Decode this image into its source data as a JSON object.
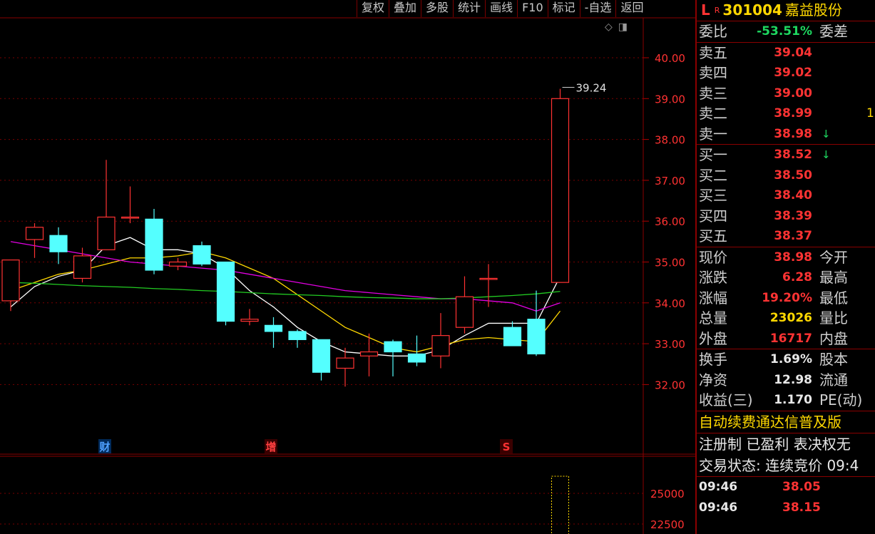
{
  "toolbar": [
    "复权",
    "叠加",
    "多股",
    "统计",
    "画线",
    "F10",
    "标记",
    "-自选",
    "返回"
  ],
  "chart_data": {
    "type": "candlestick",
    "y_ticks": [
      "40.00",
      "39.00",
      "38.00",
      "37.00",
      "36.00",
      "35.00",
      "34.00",
      "33.00",
      "32.00"
    ],
    "vol_ticks": [
      "25000",
      "22500"
    ],
    "last_high_label": "39.24",
    "event_markers": [
      "财",
      "增",
      "S"
    ],
    "candles": [
      {
        "o": 34.05,
        "c": 35.05,
        "h": 35.05,
        "l": 33.8
      },
      {
        "o": 35.55,
        "c": 35.85,
        "h": 35.95,
        "l": 35.1
      },
      {
        "o": 35.65,
        "c": 35.25,
        "h": 35.85,
        "l": 34.95
      },
      {
        "o": 34.6,
        "c": 35.15,
        "h": 35.35,
        "l": 34.5
      },
      {
        "o": 35.3,
        "c": 36.1,
        "h": 37.5,
        "l": 35.3
      },
      {
        "o": 36.1,
        "c": 36.1,
        "h": 36.85,
        "l": 35.95
      },
      {
        "o": 36.05,
        "c": 34.8,
        "h": 36.3,
        "l": 34.7
      },
      {
        "o": 34.9,
        "c": 35.0,
        "h": 35.1,
        "l": 34.8
      },
      {
        "o": 35.4,
        "c": 34.95,
        "h": 35.5,
        "l": 34.9
      },
      {
        "o": 35.0,
        "c": 33.55,
        "h": 35.0,
        "l": 33.45
      },
      {
        "o": 33.55,
        "c": 33.6,
        "h": 33.85,
        "l": 33.45
      },
      {
        "o": 33.45,
        "c": 33.3,
        "h": 33.65,
        "l": 32.9
      },
      {
        "o": 33.3,
        "c": 33.1,
        "h": 33.35,
        "l": 32.9
      },
      {
        "o": 33.1,
        "c": 32.3,
        "h": 33.1,
        "l": 32.1
      },
      {
        "o": 32.4,
        "c": 32.65,
        "h": 32.9,
        "l": 31.95
      },
      {
        "o": 32.7,
        "c": 32.8,
        "h": 33.25,
        "l": 32.2
      },
      {
        "o": 33.05,
        "c": 32.8,
        "h": 33.1,
        "l": 32.2
      },
      {
        "o": 32.75,
        "c": 32.55,
        "h": 33.2,
        "l": 32.45
      },
      {
        "o": 32.7,
        "c": 33.2,
        "h": 33.75,
        "l": 32.4
      },
      {
        "o": 33.4,
        "c": 34.15,
        "h": 34.65,
        "l": 33.25
      },
      {
        "o": 34.6,
        "c": 34.6,
        "h": 34.95,
        "l": 33.9
      },
      {
        "o": 33.4,
        "c": 32.95,
        "h": 33.55,
        "l": 32.95
      },
      {
        "o": 33.6,
        "c": 32.75,
        "h": 34.3,
        "l": 32.7
      },
      {
        "o": 34.5,
        "c": 39.0,
        "h": 39.24,
        "l": 34.5
      }
    ],
    "ma": [
      {
        "name": "MA5",
        "color": "#ffffff",
        "points": [
          33.9,
          34.4,
          34.65,
          34.8,
          35.4,
          35.6,
          35.3,
          35.3,
          35.2,
          34.85,
          34.3,
          33.9,
          33.4,
          33.05,
          32.8,
          32.75,
          32.7,
          32.7,
          32.85,
          33.2,
          33.5,
          33.5,
          33.5,
          34.65
        ]
      },
      {
        "name": "MA10",
        "color": "#ffd800",
        "points": [
          34.3,
          34.5,
          34.7,
          34.8,
          34.95,
          35.1,
          35.1,
          35.15,
          35.25,
          35.1,
          34.85,
          34.6,
          34.2,
          33.8,
          33.4,
          33.15,
          32.9,
          32.8,
          32.95,
          33.1,
          33.15,
          33.1,
          33.05,
          33.8
        ]
      },
      {
        "name": "MA20",
        "color": "#e200e2",
        "points": [
          35.5,
          35.4,
          35.3,
          35.2,
          35.1,
          35.0,
          34.95,
          34.9,
          34.85,
          34.8,
          34.7,
          34.6,
          34.5,
          34.4,
          34.3,
          34.25,
          34.2,
          34.15,
          34.1,
          34.1,
          34.05,
          34.0,
          33.8,
          34.0
        ]
      },
      {
        "name": "MA60",
        "color": "#22cc22",
        "points": [
          34.5,
          34.48,
          34.45,
          34.42,
          34.4,
          34.38,
          34.35,
          34.33,
          34.3,
          34.28,
          34.25,
          34.22,
          34.2,
          34.18,
          34.15,
          34.13,
          34.12,
          34.1,
          34.1,
          34.12,
          34.15,
          34.18,
          34.22,
          34.28
        ]
      }
    ]
  },
  "quote": {
    "market_letter": "L",
    "market_badge": "R",
    "code": "301004",
    "name": "嘉益股份",
    "weibi_label": "委比",
    "weibi_value": "-53.51%",
    "weicha_label": "委差",
    "sell": [
      {
        "label": "卖五",
        "price": "39.04",
        "arrow": "",
        "qty": ""
      },
      {
        "label": "卖四",
        "price": "39.02",
        "arrow": "",
        "qty": ""
      },
      {
        "label": "卖三",
        "price": "39.00",
        "arrow": "",
        "qty": ""
      },
      {
        "label": "卖二",
        "price": "38.99",
        "arrow": "",
        "qty": "1"
      },
      {
        "label": "卖一",
        "price": "38.98",
        "arrow": "↓",
        "qty": ""
      }
    ],
    "buy": [
      {
        "label": "买一",
        "price": "38.52",
        "arrow": "↓"
      },
      {
        "label": "买二",
        "price": "38.50",
        "arrow": ""
      },
      {
        "label": "买三",
        "price": "38.40",
        "arrow": ""
      },
      {
        "label": "买四",
        "price": "38.39",
        "arrow": ""
      },
      {
        "label": "买五",
        "price": "38.37",
        "arrow": ""
      }
    ],
    "stats": [
      {
        "l1": "现价",
        "v": "38.98",
        "c": "red",
        "l2": "今开"
      },
      {
        "l1": "涨跌",
        "v": "6.28",
        "c": "red",
        "l2": "最高"
      },
      {
        "l1": "涨幅",
        "v": "19.20%",
        "c": "red",
        "l2": "最低"
      },
      {
        "l1": "总量",
        "v": "23026",
        "c": "yellow",
        "l2": "量比"
      },
      {
        "l1": "外盘",
        "v": "16717",
        "c": "red",
        "l2": "内盘"
      }
    ],
    "fund": [
      {
        "l1": "换手",
        "v": "1.69%",
        "l2": "股本"
      },
      {
        "l1": "净资",
        "v": "12.98",
        "l2": "流通"
      },
      {
        "l1": "收益(三)",
        "v": "1.170",
        "l2": "PE(动)"
      }
    ],
    "scroll_text": "自动续费通达信普及版",
    "tags_text": "注册制 已盈利 表决权无",
    "trade_status": "交易状态: 连续竞价 09:4",
    "ticks": [
      {
        "time": "09:46",
        "price": "38.05"
      },
      {
        "time": "09:46",
        "price": "38.15"
      }
    ]
  }
}
